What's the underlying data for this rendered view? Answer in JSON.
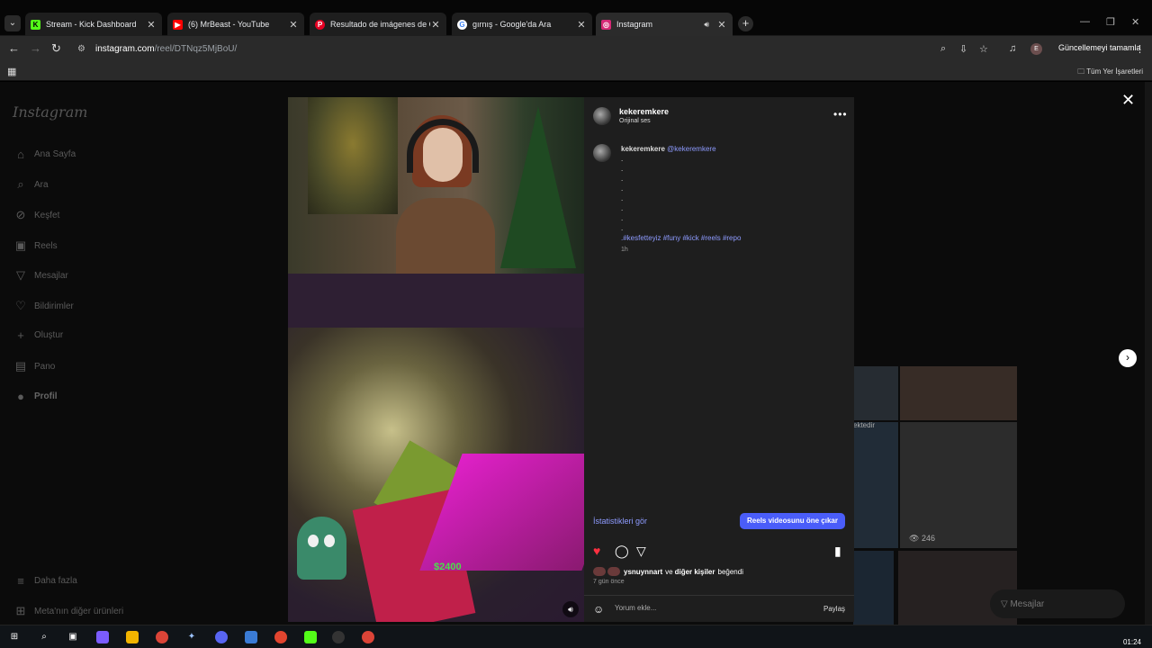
{
  "browser": {
    "tabs": [
      {
        "title": "Stream - Kick Dashboard",
        "favicon": "kick-icon",
        "color": "#53fc18",
        "glyph": "K"
      },
      {
        "title": "(6) MrBeast - YouTube",
        "favicon": "youtube-icon",
        "color": "#ff0000",
        "glyph": "▶"
      },
      {
        "title": "Resultado de imágenes de Goo",
        "favicon": "pinterest-icon",
        "color": "#e60023",
        "glyph": "P"
      },
      {
        "title": "gırnış - Google'da Ara",
        "favicon": "google-icon",
        "color": "#ffffff",
        "glyph": "G"
      },
      {
        "title": "Instagram",
        "favicon": "instagram-icon",
        "color": "#d62976",
        "glyph": "◎"
      }
    ],
    "url_host": "instagram.com",
    "url_path": "/reel/DTNqz5MjBoU/",
    "update_label": "Güncellemeyi tamamla",
    "profile_initial": "E",
    "all_bookmarks": "Tüm Yer İşaretleri"
  },
  "sidebar": {
    "logo": "Instagram",
    "items": [
      {
        "label": "Ana Sayfa",
        "icon": "home-icon"
      },
      {
        "label": "Ara",
        "icon": "search-icon"
      },
      {
        "label": "Keşfet",
        "icon": "explore-icon"
      },
      {
        "label": "Reels",
        "icon": "reels-icon"
      },
      {
        "label": "Mesajlar",
        "icon": "messages-icon"
      },
      {
        "label": "Bildirimler",
        "icon": "heart-icon"
      },
      {
        "label": "Oluştur",
        "icon": "plus-icon"
      },
      {
        "label": "Pano",
        "icon": "dashboard-icon"
      },
      {
        "label": "Profil",
        "icon": "profile-avatar"
      }
    ],
    "more": "Daha fazla",
    "meta": "Meta'nın diğer ürünleri"
  },
  "post": {
    "username": "kekeremkere",
    "audio": "Orijinal ses",
    "caption_user": "kekeremkere",
    "caption_handle": "@kekeremkere",
    "caption_dots": [
      ".",
      ".",
      ".",
      ".",
      ".",
      ".",
      ".",
      "."
    ],
    "hashtags": ".#kesfetteyiz #funy #kick #reels #repo",
    "caption_time": "1h",
    "stats_link": "İstatistikleri gör",
    "boost_button": "Reels videosunu öne çıkar",
    "liked_by_user": "ysnuynnart",
    "liked_by_mid": "ve",
    "liked_by_others": "diğer kişiler",
    "liked_by_suffix": "beğendi",
    "posted_ago": "7 gün önce",
    "comment_placeholder": "Yorum ekle...",
    "share_label": "Paylaş",
    "game_overlay": "$2400"
  },
  "background": {
    "views": "246",
    "partial_text": "ektedir",
    "messages_label": "Mesajlar"
  },
  "taskbar": {
    "clock": "01:24"
  }
}
